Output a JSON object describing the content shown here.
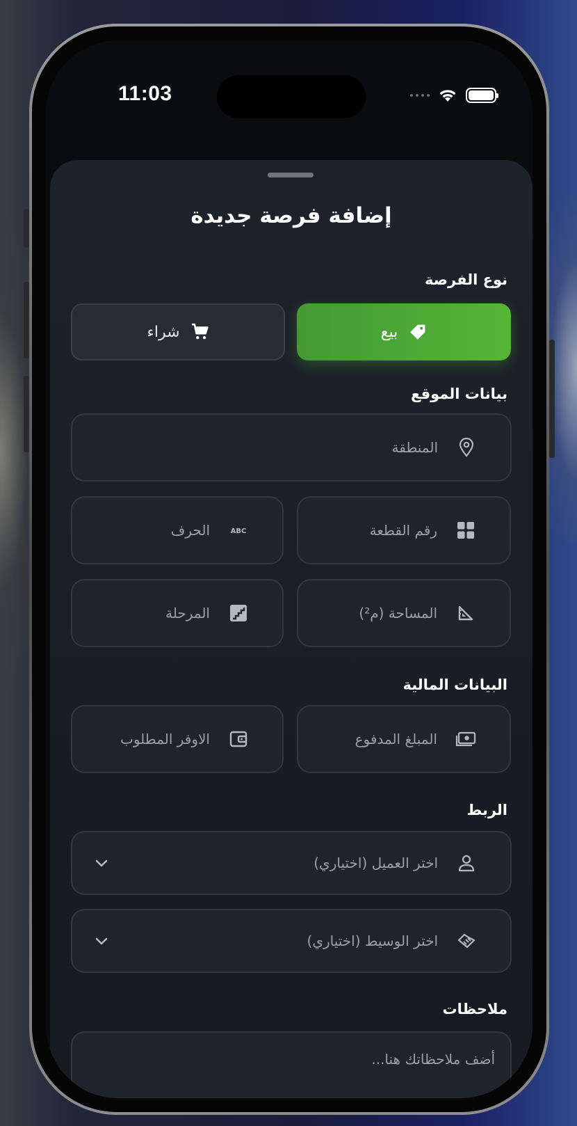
{
  "status_bar": {
    "time": "11:03"
  },
  "background_header": {
    "title": "..."
  },
  "sheet": {
    "title": "إضافة فرصة جديدة",
    "opportunity_type": {
      "label": "نوع الفرصة",
      "options": [
        {
          "label": "بيع",
          "icon": "tag-icon",
          "selected": true
        },
        {
          "label": "شراء",
          "icon": "cart-icon",
          "selected": false
        }
      ]
    },
    "location": {
      "label": "بيانات الموقع",
      "area_placeholder": "المنطقة",
      "plot_number_placeholder": "رقم القطعة",
      "letter_placeholder": "الحرف",
      "size_placeholder": "المساحة (م²)",
      "stage_placeholder": "المرحلة"
    },
    "financial": {
      "label": "البيانات المالية",
      "paid_amount_placeholder": "المبلغ المدفوع",
      "required_premium_placeholder": "الاوفر المطلوب"
    },
    "linking": {
      "label": "الربط",
      "client_placeholder": "اختر العميل (اختياري)",
      "broker_placeholder": "اختر الوسيط (اختياري)"
    },
    "notes": {
      "label": "ملاحظات",
      "placeholder": "أضف ملاحظاتك هنا..."
    }
  },
  "colors": {
    "accent_green": "#56b536",
    "sheet_bg": "#1e232b",
    "field_bg": "#1f242c"
  }
}
